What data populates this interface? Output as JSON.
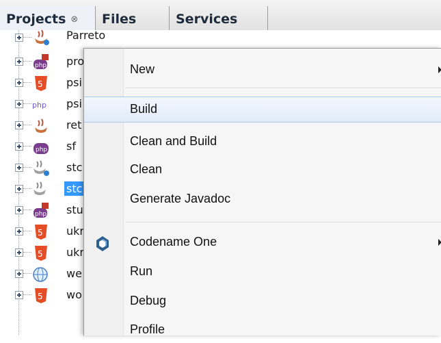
{
  "tabs": [
    {
      "label": "Projects",
      "close": "⊗",
      "active": true
    },
    {
      "label": "Files"
    },
    {
      "label": "Services"
    }
  ],
  "tree": {
    "items": [
      {
        "label": "Parreto",
        "icon": "java-project-icon"
      },
      {
        "label": "pro",
        "icon": "php-project-icon"
      },
      {
        "label": "psi",
        "icon": "html5-project-icon"
      },
      {
        "label": "psi",
        "icon": "php-project-icon"
      },
      {
        "label": "ret",
        "icon": "java-project-icon"
      },
      {
        "label": "sf",
        "icon": "php-project-icon"
      },
      {
        "label": "stc",
        "icon": "java-project-icon"
      },
      {
        "label": "stc",
        "icon": "java-project-icon",
        "selected": true
      },
      {
        "label": "stu",
        "icon": "php-project-icon"
      },
      {
        "label": "ukr",
        "icon": "html5-project-icon"
      },
      {
        "label": "ukr",
        "icon": "html5-project-icon"
      },
      {
        "label": "we",
        "icon": "web-project-icon"
      },
      {
        "label": "wo",
        "icon": "html5-project-icon"
      }
    ]
  },
  "context_menu": {
    "items": [
      {
        "label": "New",
        "submenu": true
      },
      {
        "label": "Build",
        "hover": true
      },
      {
        "label": "Clean and Build"
      },
      {
        "label": "Clean"
      },
      {
        "label": "Generate Javadoc"
      },
      {
        "label": "Codename One",
        "submenu": true,
        "icon": "codename-one-icon"
      },
      {
        "label": "Run"
      },
      {
        "label": "Debug"
      },
      {
        "label": "Profile"
      }
    ]
  }
}
